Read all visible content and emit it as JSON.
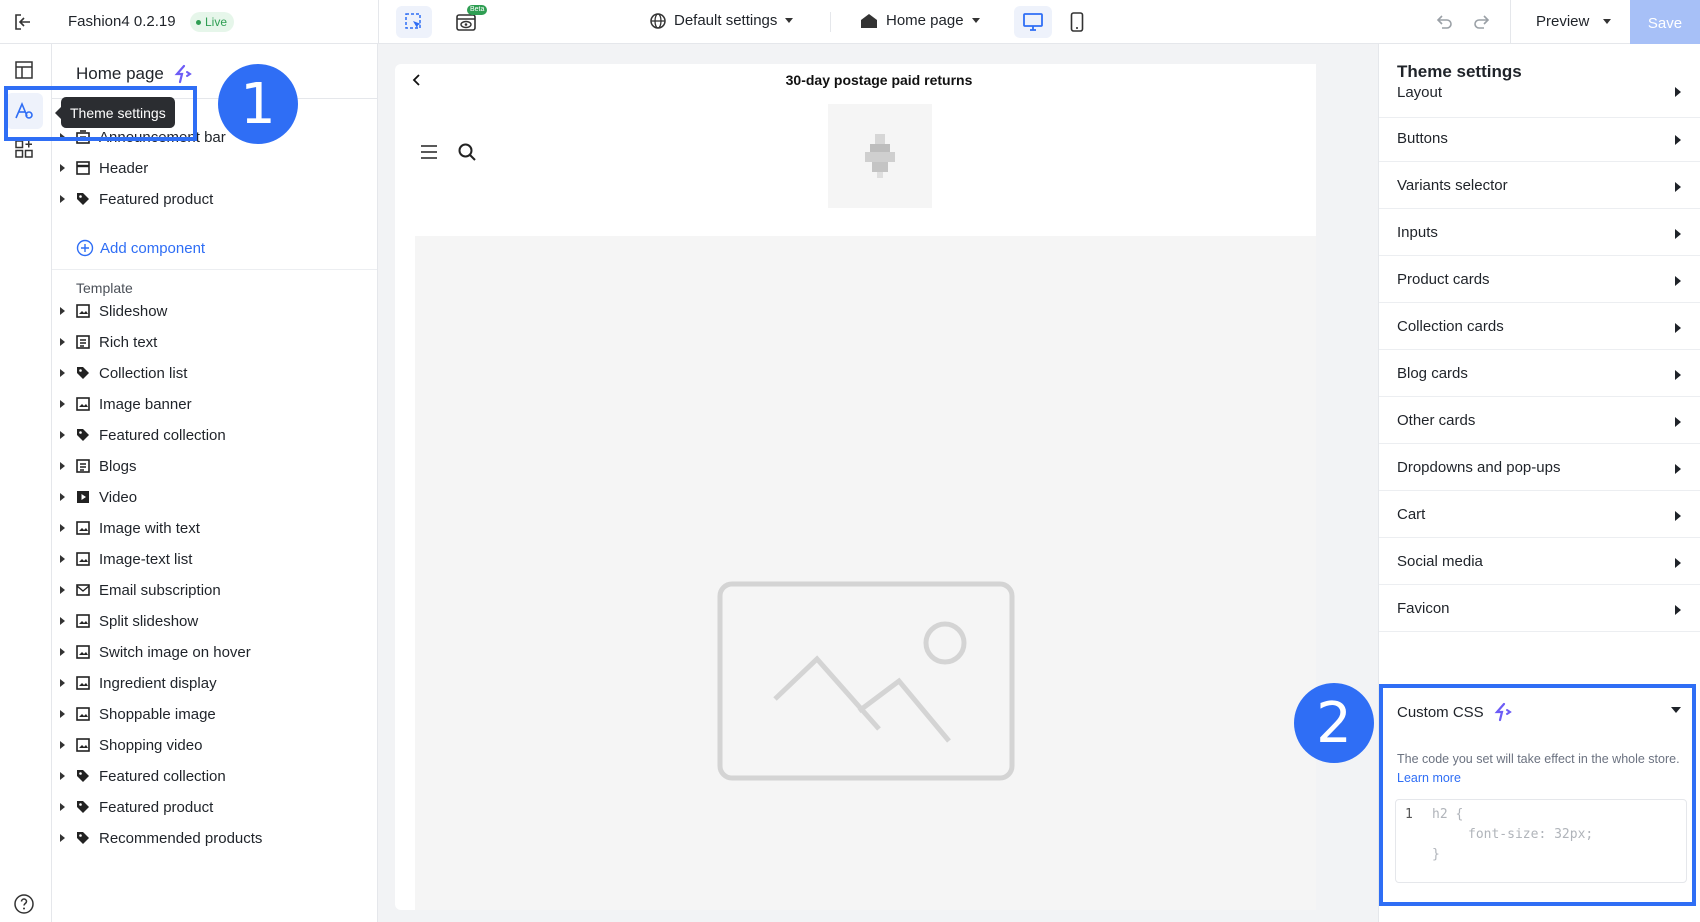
{
  "topbar": {
    "title": "Fashion4 0.2.19",
    "live_badge": "Live",
    "beta_badge": "Beta",
    "market_select": "Default settings",
    "page_select": "Home page",
    "preview_label": "Preview",
    "save_label": "Save"
  },
  "rail": {
    "tooltip": "Theme settings"
  },
  "annotations": {
    "badge1": "1",
    "badge2": "2"
  },
  "left_panel": {
    "title": "Home page",
    "header_items": [
      {
        "label": "Announcement bar"
      },
      {
        "label": "Header"
      },
      {
        "label": "Featured product"
      }
    ],
    "add_component": "Add component",
    "template_label": "Template",
    "template_items": [
      {
        "label": "Slideshow"
      },
      {
        "label": "Rich text"
      },
      {
        "label": "Collection list"
      },
      {
        "label": "Image banner"
      },
      {
        "label": "Featured collection"
      },
      {
        "label": "Blogs"
      },
      {
        "label": "Video"
      },
      {
        "label": "Image with text"
      },
      {
        "label": "Image-text list"
      },
      {
        "label": "Email subscription"
      },
      {
        "label": "Split slideshow"
      },
      {
        "label": "Switch image on hover"
      },
      {
        "label": "Ingredient display"
      },
      {
        "label": "Shoppable image"
      },
      {
        "label": "Shopping video"
      },
      {
        "label": "Featured collection"
      },
      {
        "label": "Featured product"
      },
      {
        "label": "Recommended products"
      }
    ]
  },
  "canvas": {
    "announcement": "30-day postage paid returns"
  },
  "right_panel": {
    "title": "Theme settings",
    "rows": [
      {
        "label": "Layout"
      },
      {
        "label": "Buttons"
      },
      {
        "label": "Variants selector"
      },
      {
        "label": "Inputs"
      },
      {
        "label": "Product cards"
      },
      {
        "label": "Collection cards"
      },
      {
        "label": "Blog cards"
      },
      {
        "label": "Other cards"
      },
      {
        "label": "Dropdowns and pop-ups"
      },
      {
        "label": "Cart"
      },
      {
        "label": "Social media"
      },
      {
        "label": "Favicon"
      }
    ],
    "custom_css": {
      "title": "Custom CSS",
      "description": "The code you set will take effect in the whole store.",
      "learn_more": "Learn more",
      "line_number": "1",
      "code_lines": [
        "h2 {",
        "font-size: 32px;",
        "}"
      ]
    }
  }
}
